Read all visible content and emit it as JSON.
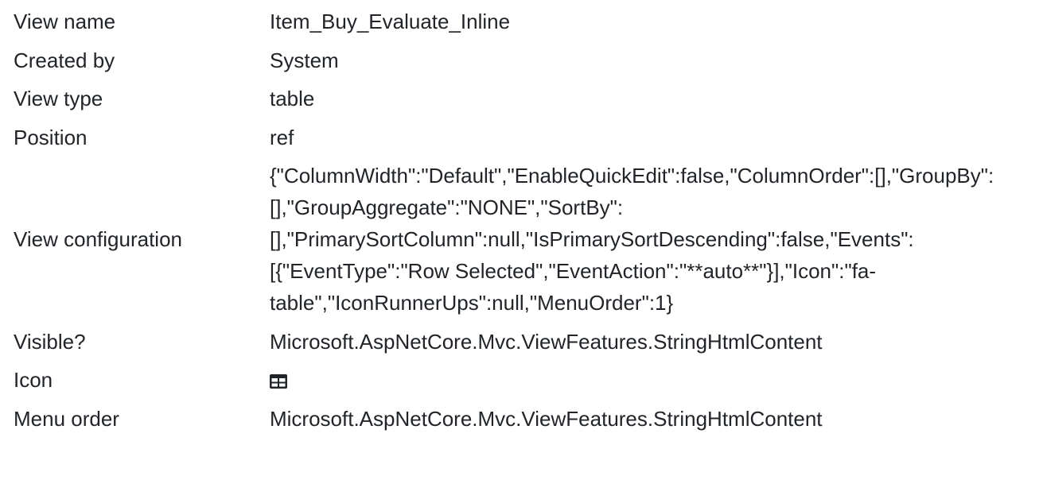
{
  "rows": [
    {
      "label": "View name",
      "value": "Item_Buy_Evaluate_Inline"
    },
    {
      "label": "Created by",
      "value": "System"
    },
    {
      "label": "View type",
      "value": "table"
    },
    {
      "label": "Position",
      "value": "ref"
    },
    {
      "label": "View configuration",
      "value": "{\"ColumnWidth\":\"Default\",\"EnableQuickEdit\":false,\"ColumnOrder\":[],\"GroupBy\":[],\"GroupAggregate\":\"NONE\",\"SortBy\":[],\"PrimarySortColumn\":null,\"IsPrimarySortDescending\":false,\"Events\":[{\"EventType\":\"Row Selected\",\"EventAction\":\"**auto**\"}],\"Icon\":\"fa-table\",\"IconRunnerUps\":null,\"MenuOrder\":1}"
    },
    {
      "label": "Visible?",
      "value": "Microsoft.AspNetCore.Mvc.ViewFeatures.StringHtmlContent"
    },
    {
      "label": "Icon",
      "icon": "table-icon"
    },
    {
      "label": "Menu order",
      "value": "Microsoft.AspNetCore.Mvc.ViewFeatures.StringHtmlContent"
    }
  ]
}
